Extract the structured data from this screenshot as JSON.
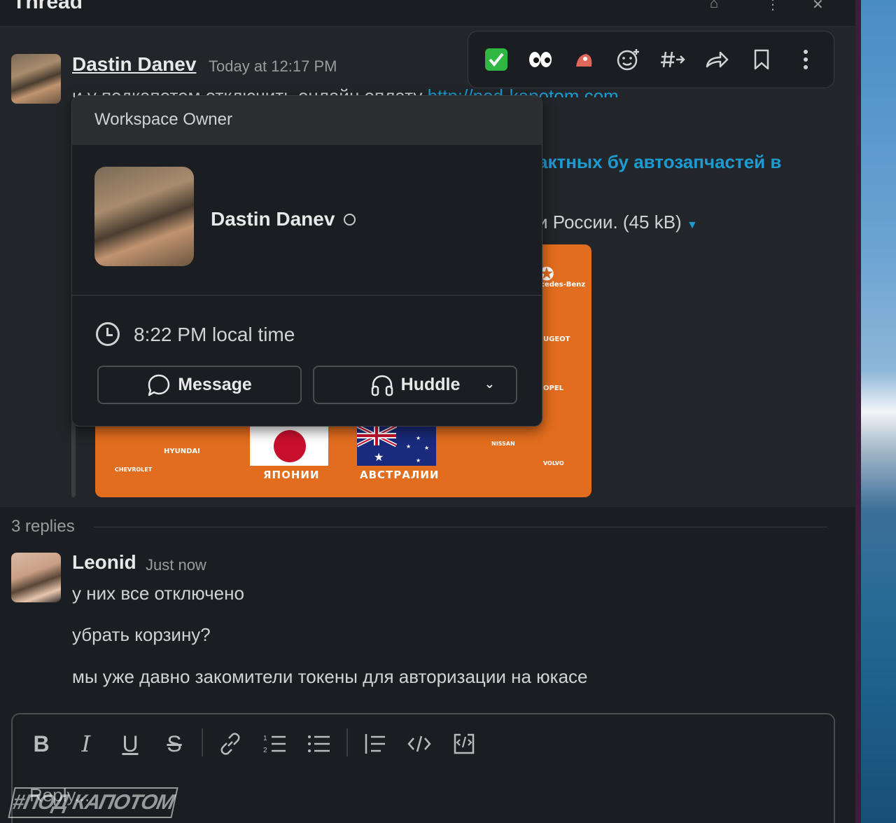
{
  "thread": {
    "title": "Thread"
  },
  "parent": {
    "author": "Dastin Danev",
    "timestamp": "Today at 12:17 PM",
    "text_visible": "и у подкапотом отключить онлайн оплату",
    "link": "http://pod-kapotom.com",
    "attachment_title_fragment": "актных бу автозапчастей в",
    "attachment_meta": "и России. (45 kB)",
    "image_labels": {
      "country_japan": "ЯПОНИИ",
      "country_australia": "АВСТРАЛИИ",
      "brands": [
        "cedes-Benz",
        "UGEOT",
        "OPEL",
        "HYUNDAI",
        "CHEVROLET",
        "NISSAN",
        "VOLVO"
      ]
    }
  },
  "toolbar": {
    "icons": [
      "check-mark-emoji",
      "eyes-emoji",
      "custom-emoji",
      "add-reaction",
      "reply-in-channel",
      "share",
      "bookmark",
      "more"
    ]
  },
  "profile_card": {
    "header": "Workspace Owner",
    "name": "Dastin Danev",
    "local_time": "8:22 PM local time",
    "message_button": "Message",
    "huddle_button": "Huddle"
  },
  "replies": {
    "count_label": "3 replies",
    "reply": {
      "author": "Leonid",
      "timestamp": "Just now",
      "lines": [
        "у них все отключено",
        "убрать корзину?",
        "мы уже давно закомители токены для авторизации на юкасе"
      ]
    }
  },
  "composer": {
    "placeholder": "Reply..."
  },
  "watermark": "#ПОД КАПОТОМ"
}
